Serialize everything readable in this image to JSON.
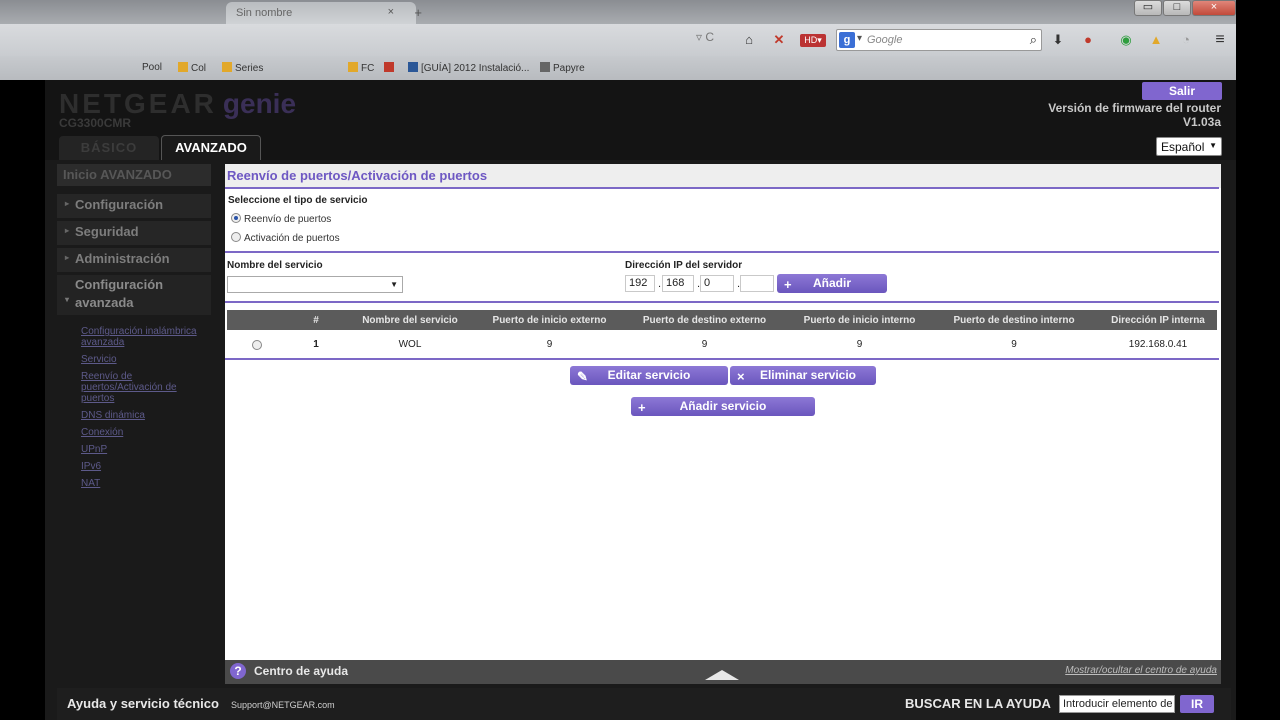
{
  "browser": {
    "tab_title": "Sin nombre",
    "tab_close": "×",
    "tab_new": "+",
    "window_buttons": [
      "▭",
      "□",
      "×"
    ],
    "url_controls": "▿ C",
    "search_engine_letter": "g",
    "search_placeholder": "Google",
    "bookmarks": [
      "Pool",
      "Col",
      "Series",
      "FC",
      "[GUÍA] 2012 Instalació...",
      "Papyre"
    ],
    "accent_icons": [
      "home-icon",
      "x-icon",
      "hd-icon",
      "download-icon",
      "abp-icon",
      "status-icon",
      "drive-icon",
      "bell-icon",
      "menu-icon"
    ]
  },
  "header": {
    "brand": "NETGEAR",
    "brand_product": "genie",
    "model": "CG3300CMR",
    "logout": "Salir",
    "firmware_label": "Versión de firmware del router",
    "firmware_version": "V1.03a",
    "tab_basic": "BÁSICO",
    "tab_advanced": "AVANZADO",
    "language": "Español"
  },
  "sidebar": {
    "home": "Inicio AVANZADO",
    "menu": [
      "Configuración",
      "Seguridad",
      "Administración"
    ],
    "advanced_menu": "Configuración avanzada",
    "links": [
      "Configuración inalámbrica avanzada",
      "Servicio",
      "Reenvío de puertos/Activación de puertos",
      "DNS dinámica",
      "Conexión",
      "UPnP",
      "IPv6",
      "NAT"
    ]
  },
  "content": {
    "title": "Reenvío de puertos/Activación de puertos",
    "service_type_label": "Seleccione el tipo de servicio",
    "radio_forwarding": "Reenvío de puertos",
    "radio_triggering": "Activación de puertos",
    "service_name_label": "Nombre del servicio",
    "service_name_value": "",
    "server_ip_label": "Dirección IP del servidor",
    "ip": [
      "192",
      "168",
      "0",
      ""
    ],
    "add_button": "Añadir",
    "table": {
      "headers": [
        "#",
        "Nombre del servicio",
        "Puerto de inicio externo",
        "Puerto de destino externo",
        "Puerto de inicio interno",
        "Puerto de destino interno",
        "Dirección IP interna"
      ],
      "rows": [
        [
          "1",
          "WOL",
          "9",
          "9",
          "9",
          "9",
          "192.168.0.41"
        ]
      ]
    },
    "edit_button": "Editar servicio",
    "delete_button": "Eliminar servicio",
    "add_service_button": "Añadir servicio"
  },
  "help": {
    "title": "Centro de ayuda",
    "toggle": "Mostrar/ocultar el centro de ayuda"
  },
  "footer": {
    "title": "Ayuda y servicio técnico",
    "email": "Support@NETGEAR.com",
    "search_label": "BUSCAR EN LA AYUDA",
    "search_value": "Introducir elemento de",
    "go": "IR"
  },
  "colors": {
    "accent": "#7c68c6",
    "header_bg": "#141414",
    "table_header": "#5b5b5b"
  }
}
